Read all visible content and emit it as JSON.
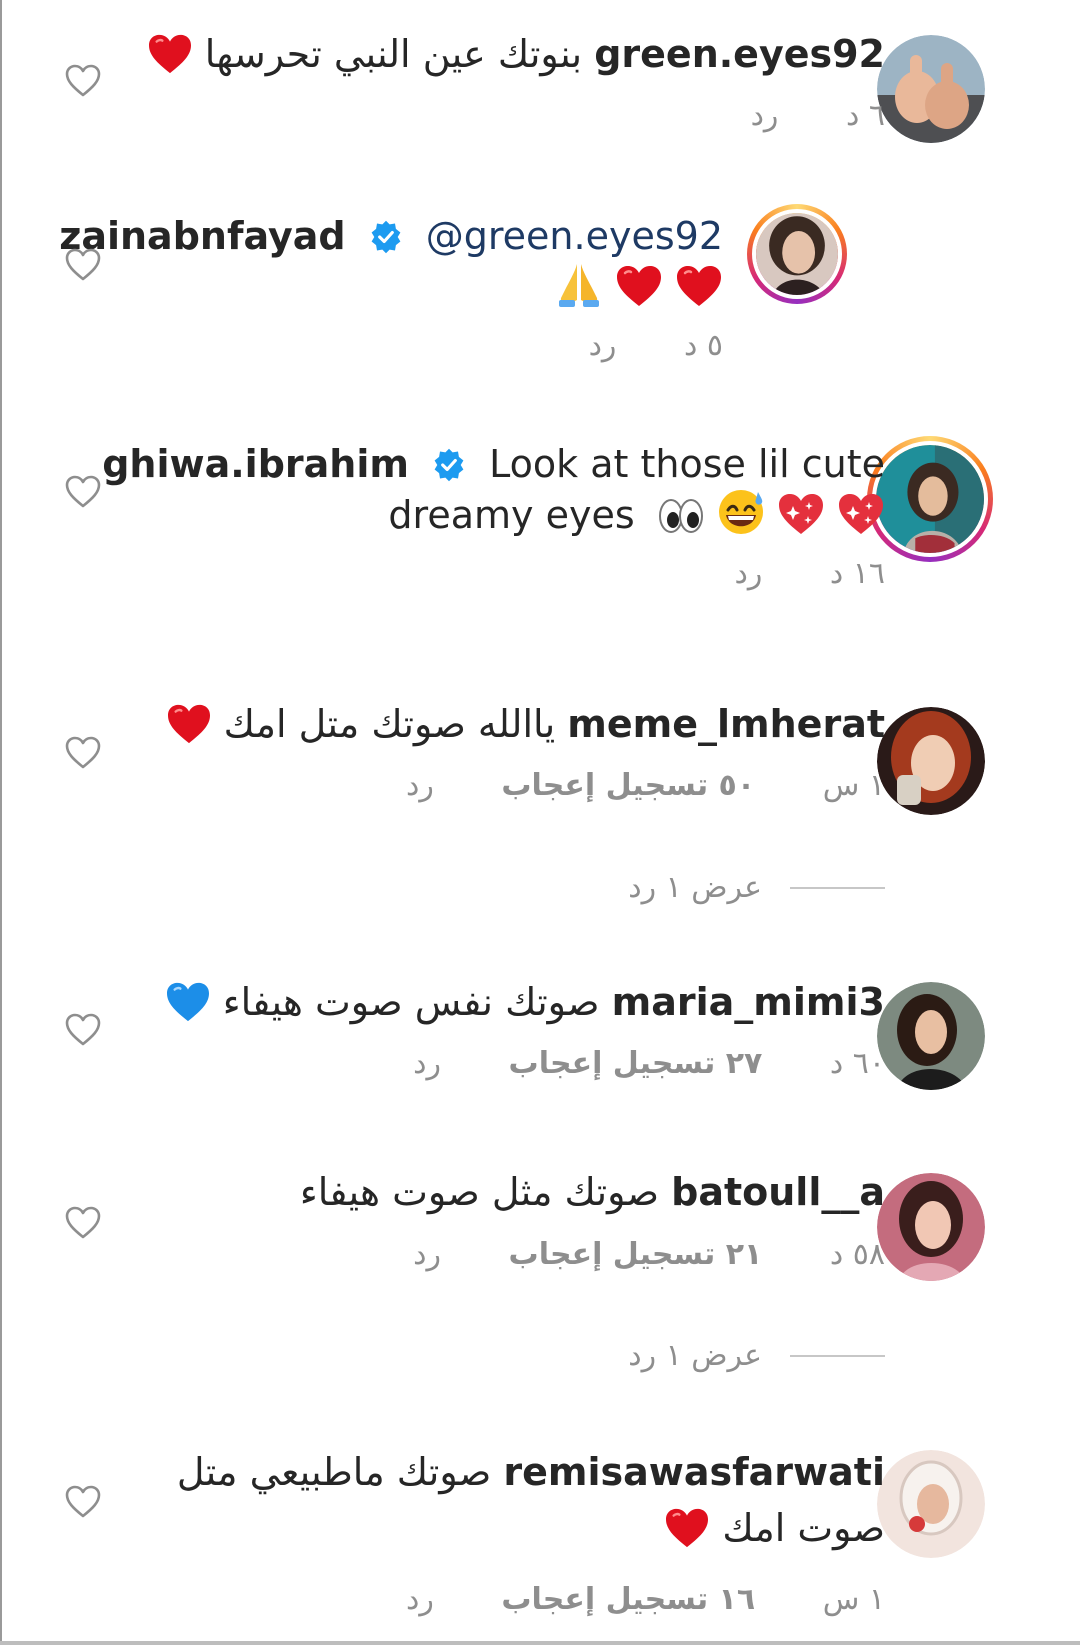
{
  "comments": [
    {
      "username": "green.eyes92",
      "text": "بنوتك عين النبي تحرسها",
      "emoji": [
        "red-heart"
      ],
      "time": "٦ د",
      "reply": "رد"
    },
    {
      "username": "zainabnfayad",
      "verified": true,
      "mention": "@green.eyes92",
      "emoji": [
        "red-heart",
        "red-heart",
        "folded-hands"
      ],
      "time": "٥ د",
      "reply": "رد"
    },
    {
      "username": "ghiwa.ibrahim",
      "verified": true,
      "text_line1": "Look at those lil cute",
      "text_line2": "dreamy eyes",
      "emoji": [
        "eyes",
        "grinning-sweat",
        "sparkling-heart",
        "sparkling-heart"
      ],
      "time": "١٦ د",
      "reply": "رد"
    },
    {
      "username": "meme_lmherat",
      "text": "ياالله صوتك متل امك",
      "emoji": [
        "red-heart"
      ],
      "time": "١ س",
      "likes": "٥٠ تسجيل إعجاب",
      "reply": "رد",
      "view_replies": "عرض ١ رد"
    },
    {
      "username": "maria_mimi3",
      "text": "صوتك نفس صوت هيفاء",
      "emoji": [
        "blue-heart"
      ],
      "time": "٦٠ د",
      "likes": "٢٧ تسجيل إعجاب",
      "reply": "رد"
    },
    {
      "username": "batoull__a",
      "text": "صوتك مثل صوت هيفاء",
      "time": "٥٨ د",
      "likes": "٢١ تسجيل إعجاب",
      "reply": "رد",
      "view_replies": "عرض ١ رد"
    },
    {
      "username": "remisawasfarwati",
      "text_line1": "صوتك ماطبيعي متل",
      "text_line2": "صوت امك",
      "emoji": [
        "red-heart"
      ],
      "time": "١ س",
      "likes": "١٦ تسجيل إعجاب",
      "reply": "رد"
    }
  ],
  "colors": {
    "username": "#262626",
    "meta": "#8e8e8e",
    "mention": "#1e3a64",
    "verified": "#1da1f2",
    "heart_outline": "#8e8e8e"
  },
  "icons": {
    "like": "heart-outline-icon",
    "verified": "verified-badge-icon"
  }
}
